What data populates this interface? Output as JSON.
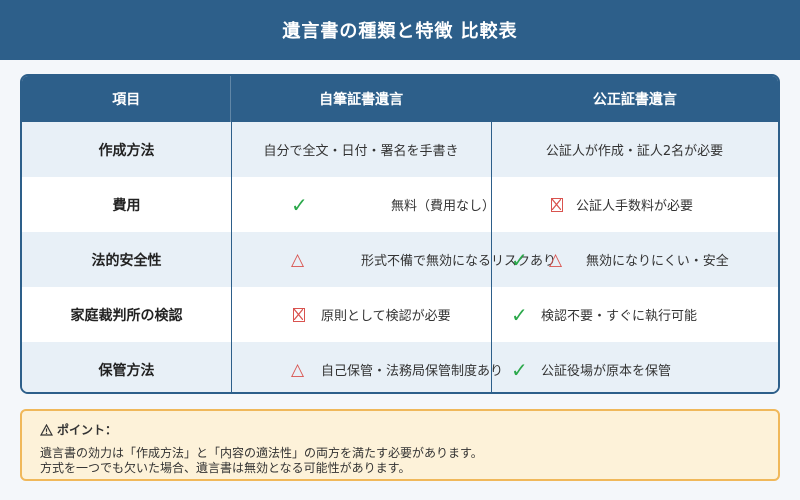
{
  "title": "遺言書の種類と特徴 比較表",
  "table": {
    "headers": [
      "項目",
      "自筆証書遺言",
      "公正証書遺言"
    ],
    "rows": [
      {
        "label": "作成方法",
        "a_text": "自分で全文・日付・署名を手書き",
        "b_text": "公証人が作成・証人2名が必要"
      },
      {
        "label": "費用",
        "a_icon": "check-icon",
        "a_text": "無料（費用なし）",
        "b_icon": "x-box-icon",
        "b_text": "公証人手数料が必要"
      },
      {
        "label": "法的安全性",
        "a_icon": "triangle-icon",
        "a_text": "形式不備で無効になるリスクあり",
        "b_icon": "check-icon",
        "b_icon2": "triangle-icon",
        "b_text": "無効になりにくい・安全"
      },
      {
        "label": "家庭裁判所の検認",
        "a_icon": "x-box-icon",
        "a_text": "原則として検認が必要",
        "b_icon": "check-icon",
        "b_text": "検認不要・すぐに執行可能"
      },
      {
        "label": "保管方法",
        "a_icon": "triangle-icon",
        "a_text": "自己保管・法務局保管制度あり",
        "b_icon": "check-icon",
        "b_text": "公証役場が原本を保管"
      }
    ]
  },
  "point": {
    "icon": "warning-icon",
    "title": "ポイント：",
    "lines": [
      "遺言書の効力は「作成方法」と「内容の適法性」の両方を満たす必要があります。",
      "方式を一つでも欠いた場合、遺言書は無効となる可能性があります。"
    ]
  },
  "colors": {
    "header_bg": "#2d5f8a",
    "row_alt": "#e8f0f7",
    "check": "#2aa84a",
    "warn": "#d9534f",
    "point_bg": "#fdf2d9",
    "point_border": "#f0b85a"
  }
}
